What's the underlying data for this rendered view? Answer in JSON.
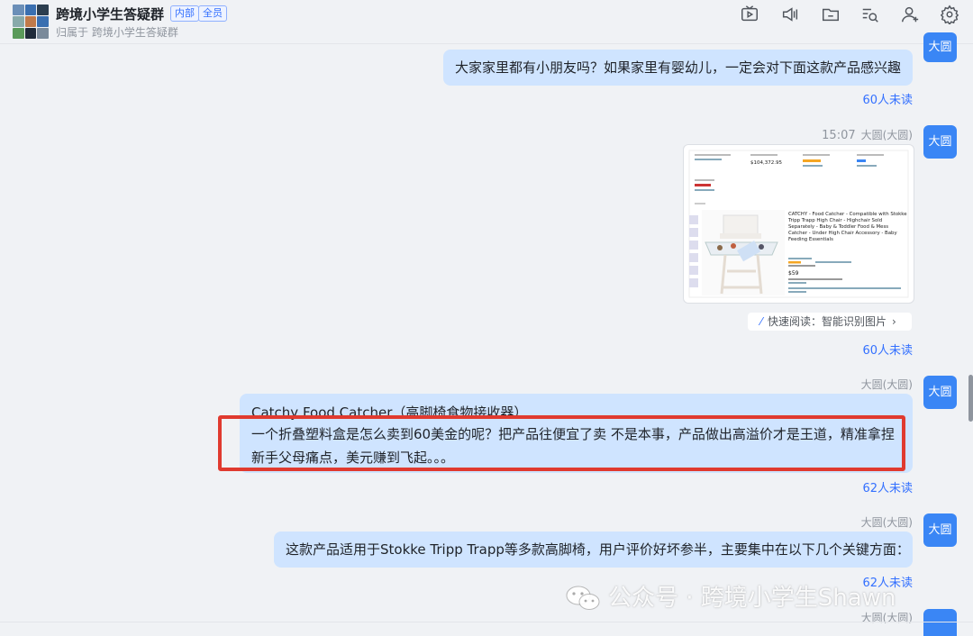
{
  "header": {
    "title": "跨境小学生答疑群",
    "badge_internal": "内部",
    "badge_all": "全员",
    "subtitle": "归属于 跨境小学生答疑群"
  },
  "avatar_name": "大圆",
  "messages": [
    {
      "text": "大家家里都有小朋友吗？如果家里有婴幼儿，一定会对下面这款产品感兴趣",
      "unread": "60人未读"
    },
    {
      "time": "15:07",
      "sender": "大圆(大圆)",
      "unread": "60人未读",
      "quick_read": "快速阅读：智能识别图片"
    },
    {
      "sender": "大圆(大圆)",
      "line1": "Catchy Food Catcher（高脚椅食物接收器）",
      "line2": "一个折叠塑料盒是怎么卖到60美金的呢？把产品往便宜了卖 不是本事，产品做出高溢价才是王道，精准拿捏",
      "line3": "新手父母痛点，美元赚到飞起。。。",
      "unread": "62人未读"
    },
    {
      "sender": "大圆(大圆)",
      "text": "这款产品适用于Stokke Tripp Trapp等多款高脚椅，用户评价好坏参半，主要集中在以下几个关键方面：",
      "unread": "62人未读"
    },
    {
      "sender": "大圆(大圆)"
    }
  ],
  "screenshot": {
    "price_label": "$104,372.95",
    "product_title": "CATCHY - Food Catcher - Compatible with Stokke Tripp Trapp High Chair - Highchair Sold Separately - Baby & Toddler Food & Mess Catcher - Under High Chair Accessory - Baby Feeding Essentials",
    "price": "$59"
  },
  "watermark": "公众号 · 跨境小学生Shawn",
  "colors": {
    "bubble": "#cfe4ff",
    "avatar": "#3a86f5",
    "unread": "#3370ff",
    "frame": "#e03a2f"
  }
}
